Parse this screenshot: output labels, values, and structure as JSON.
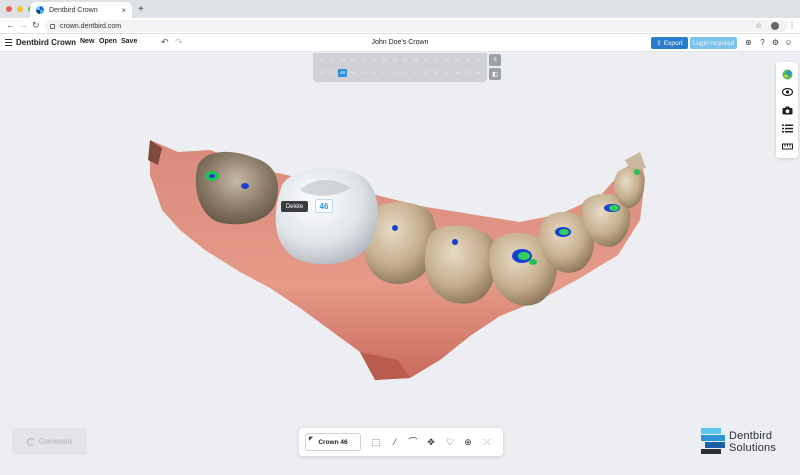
{
  "browser": {
    "tab_title": "Dentbird Crown",
    "tab_close": "×",
    "new_tab": "+",
    "url": "crown.dentbird.com",
    "traffic_colors": [
      "#ee5e57",
      "#f6bd2e",
      "#5cc63f"
    ]
  },
  "app": {
    "brand": "Dentbird Crown",
    "menu": {
      "new": "New",
      "open": "Open",
      "save": "Save"
    },
    "document_title": "John Doe's Crown",
    "export_label": "Export",
    "login_label": "Login required",
    "accent": "#2a7ccc"
  },
  "tooth_chart": {
    "upper": [
      "18",
      "17",
      "16",
      "15",
      "14",
      "13",
      "12",
      "11",
      "21",
      "22",
      "23",
      "24",
      "25",
      "26",
      "27",
      "28"
    ],
    "lower": [
      "48",
      "47",
      "46",
      "45",
      "44",
      "43",
      "42",
      "41",
      "31",
      "32",
      "33",
      "34",
      "35",
      "36",
      "37",
      "38"
    ],
    "selected": "46"
  },
  "viewport": {
    "delete_label": "Delete",
    "tooth_number": "46"
  },
  "generate": {
    "label": "Generate"
  },
  "bottom_toolbar": {
    "crown_label": "Crown 46"
  },
  "logo": {
    "line1": "Dentbird",
    "line2": "Solutions"
  }
}
